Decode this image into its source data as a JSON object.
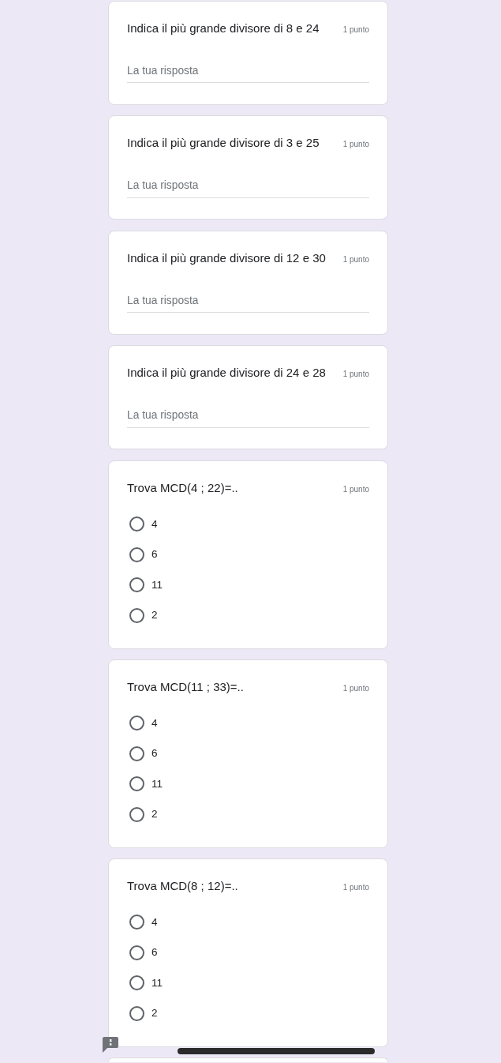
{
  "questions": [
    {
      "kind": "text",
      "title": "Indica il più grande divisore di 8 e 24",
      "points": "1 punto",
      "placeholder": "La tua risposta"
    },
    {
      "kind": "text",
      "title": "Indica il più grande divisore di 3 e 25",
      "points": "1 punto",
      "placeholder": "La tua risposta"
    },
    {
      "kind": "text",
      "title": "Indica il più grande divisore di 12 e 30",
      "points": "1 punto",
      "placeholder": "La tua risposta"
    },
    {
      "kind": "text",
      "title": "Indica il più grande divisore di 24 e 28",
      "points": "1 punto",
      "placeholder": "La tua risposta"
    },
    {
      "kind": "radio",
      "title": "Trova MCD(4 ; 22)=..",
      "points": "1 punto",
      "options": [
        {
          "label": "4",
          "selected": false
        },
        {
          "label": "6",
          "selected": false
        },
        {
          "label": "11",
          "selected": false
        },
        {
          "label": "2",
          "selected": false
        }
      ]
    },
    {
      "kind": "radio",
      "title": "Trova MCD(11 ; 33)=..",
      "points": "1 punto",
      "options": [
        {
          "label": "4",
          "selected": false
        },
        {
          "label": "6",
          "selected": false
        },
        {
          "label": "11",
          "selected": false
        },
        {
          "label": "2",
          "selected": false
        }
      ]
    },
    {
      "kind": "radio",
      "title": "Trova MCD(8 ; 12)=..",
      "points": "1 punto",
      "options": [
        {
          "label": "4",
          "selected": false
        },
        {
          "label": "6",
          "selected": false
        },
        {
          "label": "11",
          "selected": false
        },
        {
          "label": "2",
          "selected": false
        }
      ]
    }
  ]
}
